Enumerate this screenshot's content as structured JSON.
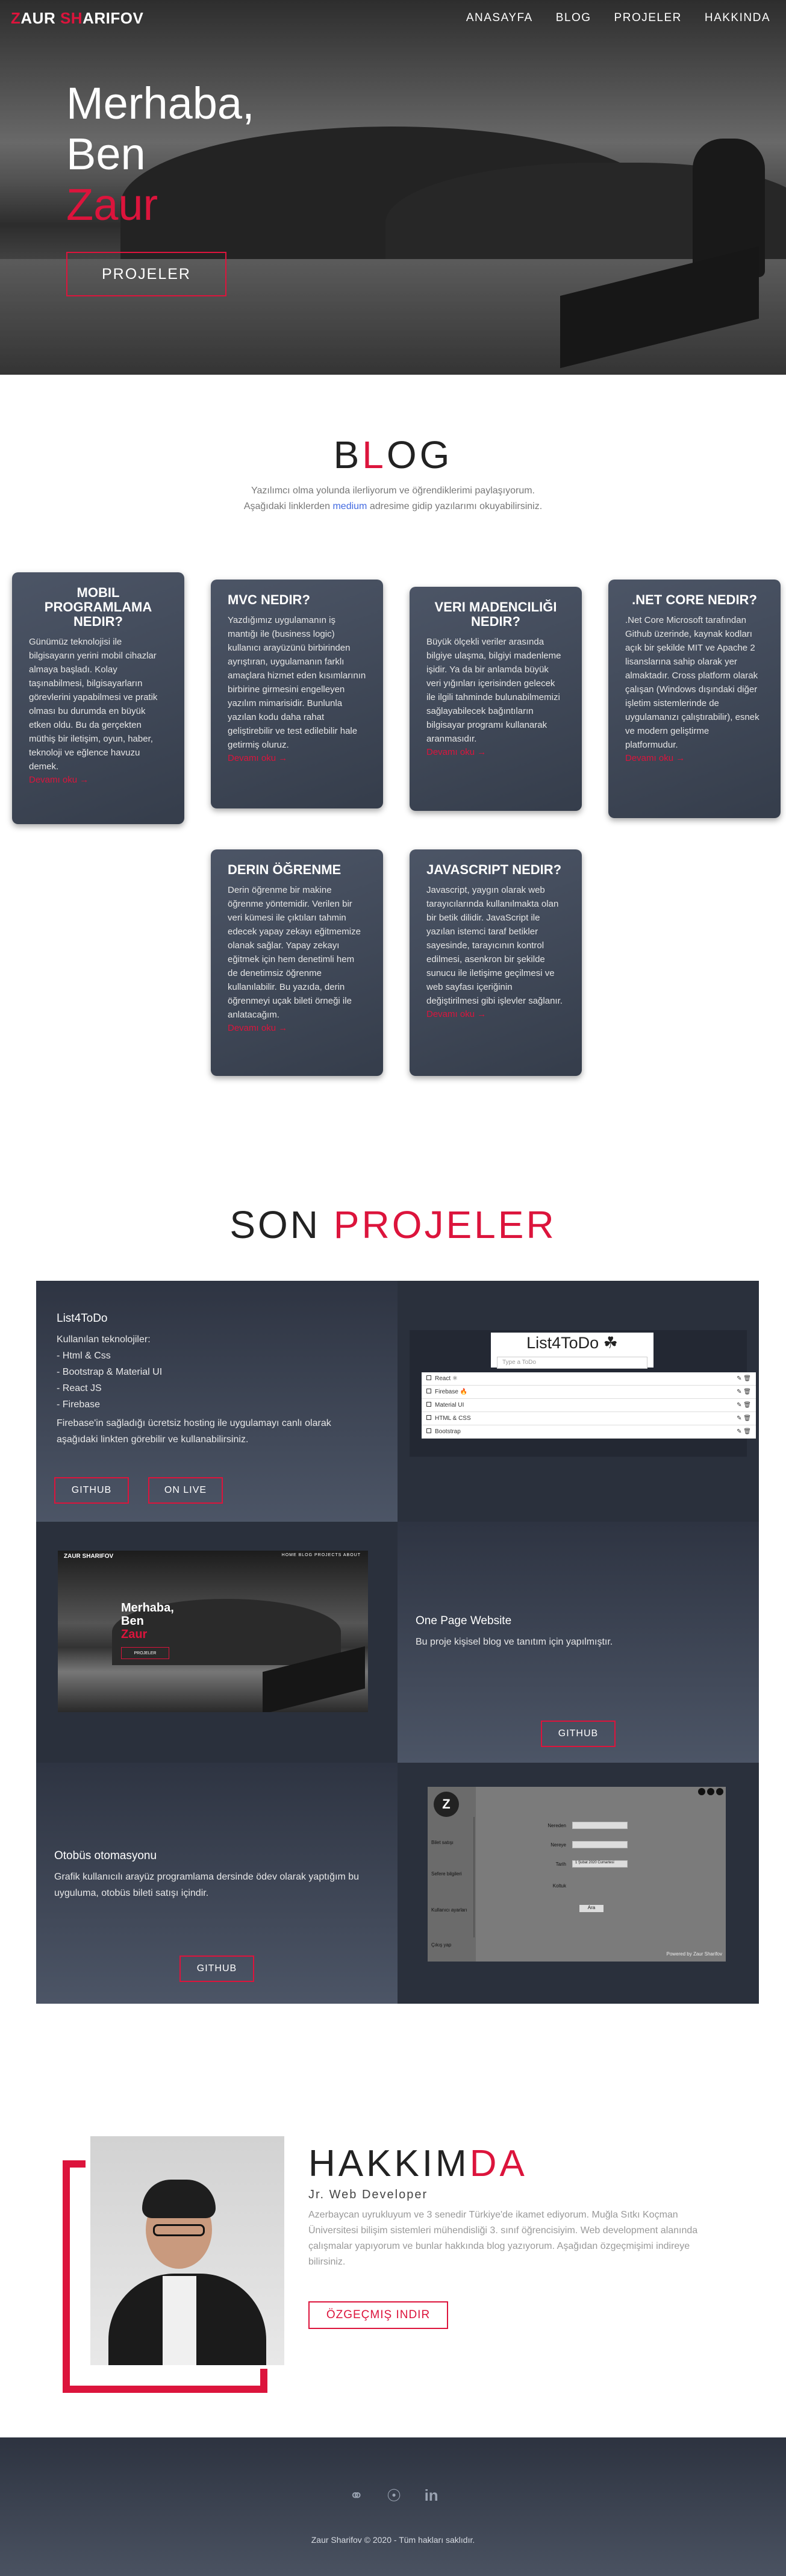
{
  "nav": {
    "logo_prefix": "Z",
    "logo_a": "AUR ",
    "logo_red": "SH",
    "logo_b": "ARIFOV",
    "links": [
      "ANASAYFA",
      "BLOG",
      "PROJELER",
      "HAKKINDA"
    ]
  },
  "hero": {
    "line1": "Merhaba,",
    "line2": "Ben",
    "line3": "Zaur",
    "button": "PROJELER"
  },
  "blog": {
    "title_a": "B",
    "title_red": "L",
    "title_b": "OG",
    "subtitle_a": "Yazılımcı olma yolunda ilerliyorum ve öğrendiklerimi paylaşıyorum. Aşağıdaki linklerden ",
    "subtitle_link": "medium",
    "subtitle_b": " adresime gidip yazılarımı okuyabilirsiniz.",
    "cards": [
      {
        "title": "MOBIL PROGRAMLAMA NEDIR?",
        "text": "Günümüz teknolojisi ile bilgisayarın yerini mobil cihazlar almaya başladı. Kolay taşınabilmesi, bilgisayarların görevlerini yapabilmesi ve pratik olması bu durumda en büyük etken oldu. Bu da gerçekten müthiş bir iletişim, oyun, haber, teknoloji ve eğlence havuzu demek.",
        "more": "Devamı oku →"
      },
      {
        "title": "MVC NEDIR?",
        "text": "Yazdığımız uygulamanın iş mantığı ile (business logic) kullanıcı arayüzünü birbirinden ayrıştıran, uygulamanın farklı amaçlara hizmet eden kısımlarının birbirine girmesini engelleyen yazılım mimarisidir. Bunlunla yazılan kodu daha rahat geliştirebilir ve test edilebilir hale getirmiş oluruz.",
        "more": "Devamı oku →"
      },
      {
        "title": "VERI MADENCILIĞI NEDIR?",
        "text": "Büyük ölçekli veriler arasında bilgiye ulaşma, bilgiyi madenleme işidir. Ya da bir anlamda büyük veri yığınları içerisinden gelecek ile ilgili tahminde bulunabilmemizi sağlayabilecek bağıntıların bilgisayar programı kullanarak aranmasıdır.",
        "more": "Devamı oku →"
      },
      {
        "title": ".NET CORE NEDIR?",
        "text": ".Net Core Microsoft tarafından Github üzerinde, kaynak kodları açık bir şekilde MIT ve Apache 2 lisanslarına sahip olarak yer almaktadır. Cross platform olarak çalışan (Windows dışındaki diğer işletim sistemlerinde de uygulamanızı çalıştırabilir), esnek ve modern geliştirme platformudur.",
        "more": "Devamı oku →"
      },
      {
        "title": "DERIN ÖĞRENME",
        "text": "Derin öğrenme bir makine öğrenme yöntemidir. Verilen bir veri kümesi ile çıktıları tahmin edecek yapay zekayı eğitmemize olanak sağlar. Yapay zekayı eğitmek için hem denetimli hem de denetimsiz öğrenme kullanılabilir. Bu yazıda, derin öğrenmeyi uçak bileti örneği ile anlatacağım.",
        "more": "Devamı oku →"
      },
      {
        "title": "JAVASCRIPT NEDIR?",
        "text": "Javascript, yaygın olarak web tarayıcılarında kullanılmakta olan bir betik dilidir. JavaScript ile yazılan istemci taraf betikler sayesinde, tarayıcının kontrol edilmesi, asenkron bir şekilde sunucu ile iletişime geçilmesi ve web sayfası içeriğinin değiştirilmesi gibi işlevler sağlanır.",
        "more": "Devamı oku →"
      }
    ]
  },
  "projects": {
    "title_a": "SON ",
    "title_red": "PROJELER",
    "todo": {
      "title": "List4ToDo",
      "lines": [
        "Kullanılan teknolojiler:",
        "- Html & Css",
        "- Bootstrap & Material UI",
        "- React JS",
        "- Firebase"
      ],
      "desc": "Firebase'in sağladığı ücretsiz hosting ile uygulamayı canlı olarak aşağıdaki linkten görebilir ve kullanabilirsiniz.",
      "btn_github": "GITHUB",
      "btn_live": "ON LIVE",
      "mock_title": "List4ToDo ☘",
      "mock_placeholder": "Type a ToDo",
      "mock_items": [
        "React ⚛",
        "Firebase 🔥",
        "Material UI",
        "HTML & CSS",
        "Bootstrap"
      ]
    },
    "onepage": {
      "title": "One Page Website",
      "desc": "Bu proje kişisel blog ve tanıtım için yapılmıştır.",
      "btn_github": "GITHUB",
      "mock_logo": "ZAUR SHARIFOV",
      "mock_links": "HOME   BLOG   PROJECTS   ABOUT",
      "mock_line1": "Merhaba,",
      "mock_line2": "Ben",
      "mock_line3": "Zaur",
      "mock_btn": "PROJELER"
    },
    "bus": {
      "title": "Otobüs otomasyonu",
      "desc": "Grafik kullanıcılı arayüz programlama dersinde ödev olarak yaptığım bu uyguluma, otobüs bileti satışı içindir.",
      "btn_github": "GITHUB",
      "mock_logo": "Z",
      "side_items": [
        "Bilet satışı",
        "Sefere bilgileri",
        "Kullanıcı ayarları",
        "Çıkış yap"
      ],
      "fields": [
        "Nereden",
        "Nereye",
        "Tarih",
        "Koltuk"
      ],
      "date_value": "1 Şubat 2020 Cumartesi",
      "go": "Ara",
      "footer_text": "Powered by Zaur Sharifov"
    }
  },
  "about": {
    "title_a": "HAKKIM",
    "title_red": "DA",
    "role": "Jr. Web Developer",
    "text": "Azerbaycan uyrukluyum ve 3 senedir Türkiye'de ikamet ediyorum. Muğla Sıtkı Koçman Üniversitesi bilişim sistemleri mühendisliği 3. sınıf öğrencisiyim. Web development alanında çalışmalar yapıyorum ve bunlar hakkında blog yazıyorum. Aşağıdan özgeçmişimi indireye bilirsiniz.",
    "button": "ÖZGEÇMIŞ INDIR"
  },
  "footer": {
    "icons": [
      "medium-icon",
      "github-icon",
      "linkedin-icon"
    ],
    "copy": "Zaur Sharifov © 2020 - Tüm hakları saklıdır."
  }
}
